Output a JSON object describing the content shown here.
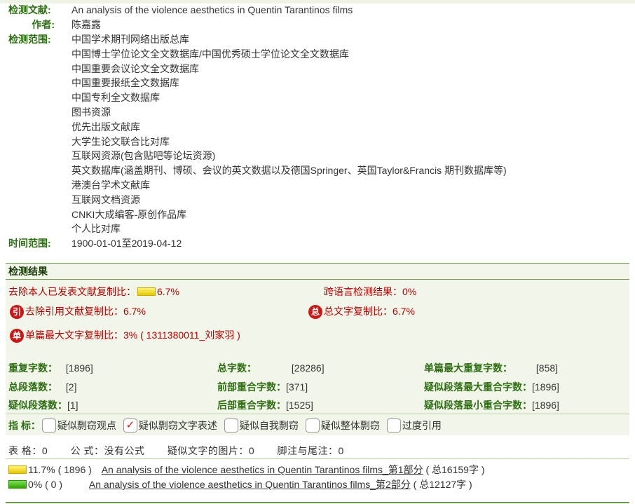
{
  "meta": {
    "doc_label": "检测文献:",
    "doc_value": "An analysis of the violence aesthetics in Quentin Tarantinos films",
    "author_label": "作者:",
    "author_value": "陈嘉露",
    "scope_label": "检测范围:",
    "databases": [
      "中国学术期刊网络出版总库",
      "中国博士学位论文全文数据库/中国优秀硕士学位论文全文数据库",
      "中国重要会议论文全文数据库",
      "中国重要报纸全文数据库",
      "中国专利全文数据库",
      "图书资源",
      "优先出版文献库",
      "大学生论文联合比对库",
      "互联网资源(包含贴吧等论坛资源)",
      "英文数据库(涵盖期刊、博硕、会议的英文数据以及德国Springer、英国Taylor&Francis 期刊数据库等)",
      "港澳台学术文献库",
      "互联网文档资源",
      "CNKI大成编客-原创作品库",
      "个人比对库"
    ],
    "time_label": "时间范围:",
    "time_value": "1900-01-01至2019-04-12"
  },
  "results": {
    "header": "检测结果",
    "self_excluded_label": "去除本人已发表文献复制比：",
    "self_excluded_value": "6.7%",
    "cross_lang_label": "跨语言检测结果：",
    "cross_lang_value": "0%",
    "cite_badge": "引",
    "cite_excluded_label": "去除引用文献复制比：",
    "cite_excluded_value": "6.7%",
    "total_badge": "总",
    "total_copy_label": "总文字复制比：",
    "total_copy_value": "6.7%",
    "single_badge": "单",
    "single_max_label": "单篇最大文字复制比：",
    "single_max_value": "3%",
    "single_max_source": "( 1311380011_刘家羽 )",
    "stats": {
      "repeat_chars_label": "重复字数：",
      "repeat_chars_value": "[1896]",
      "total_chars_label": "总字数：",
      "total_chars_value": "[28286]",
      "single_max_repeat_label": "单篇最大重复字数：",
      "single_max_repeat_value": "[858]",
      "total_paras_label": "总段落数：",
      "total_paras_value": "[2]",
      "front_overlap_label": "前部重合字数：",
      "front_overlap_value": "[371]",
      "para_max_overlap_label": "疑似段落最大重合字数：",
      "para_max_overlap_value": "[1896]",
      "suspect_paras_label": "疑似段落数：",
      "suspect_paras_value": "[1]",
      "back_overlap_label": "后部重合字数：",
      "back_overlap_value": "[1525]",
      "para_min_overlap_label": "疑似段落最小重合字数：",
      "para_min_overlap_value": "[1896]"
    },
    "indicators_label": "指  标：",
    "indicators": [
      {
        "label": "疑似剽窃观点",
        "checked": false
      },
      {
        "label": "疑似剽窃文字表述",
        "checked": true
      },
      {
        "label": "疑似自我剽窃",
        "checked": false
      },
      {
        "label": "疑似整体剽窃",
        "checked": false
      },
      {
        "label": "过度引用",
        "checked": false
      }
    ],
    "check_mark": "✓"
  },
  "summary": {
    "tables": "表 格：0",
    "formulas": "公 式：没有公式",
    "images": "疑似文字的图片：0",
    "footnotes": "脚注与尾注：0"
  },
  "parts": [
    {
      "pct": "11.7%",
      "count": "( 1896 )",
      "title": "An analysis of the violence aesthetics in Quentin Tarantinos films_第1部分",
      "total": "( 总16159字 )",
      "bar": "yellow",
      "fill": 0.117
    },
    {
      "pct": "0%",
      "count": "( 0 )",
      "title": "An analysis of the violence aesthetics in Quentin Tarantinos films_第2部分",
      "total": "( 总12127字 )",
      "bar": "green",
      "fill": 0
    }
  ],
  "colors": {
    "label_green": "#2e6e12",
    "value_red": "#b00000",
    "panel_bg": "#f2f6ea",
    "border_green": "#6a9a4a"
  }
}
